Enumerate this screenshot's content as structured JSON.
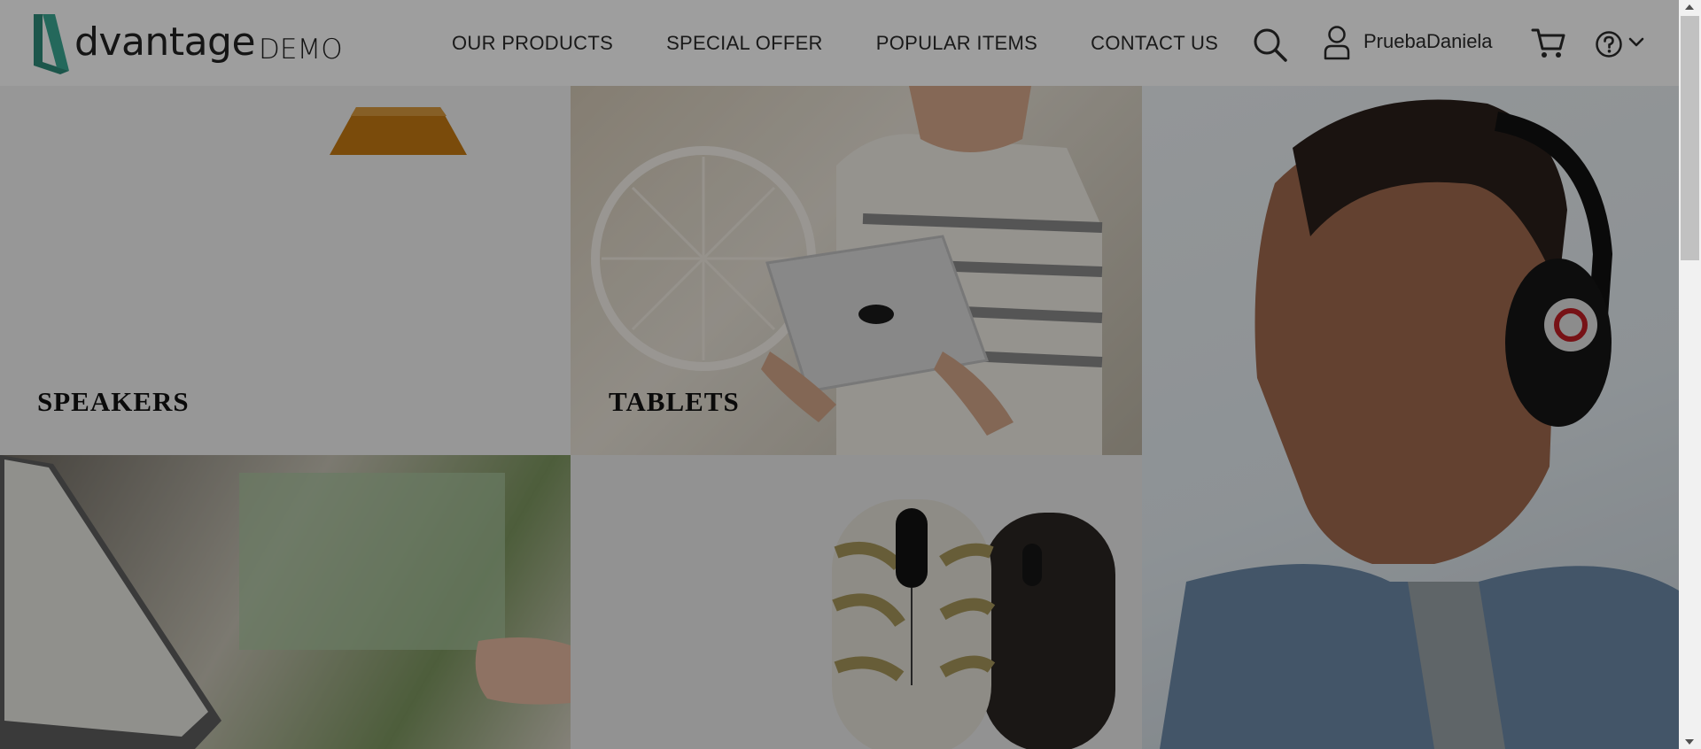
{
  "header": {
    "logo": {
      "word": "dvantage",
      "suffix": "DEMO"
    },
    "nav": [
      {
        "label": "OUR PRODUCTS"
      },
      {
        "label": "SPECIAL OFFER"
      },
      {
        "label": "POPULAR ITEMS"
      },
      {
        "label": "CONTACT US"
      }
    ],
    "icons": {
      "search": "search-icon",
      "user": "user-icon",
      "cart": "cart-icon",
      "help": "help-icon",
      "dropdown": "chevron-down-icon"
    },
    "user_name": "PruebaDaniela"
  },
  "categories": [
    {
      "id": "speakers",
      "label": "SPEAKERS"
    },
    {
      "id": "tablets",
      "label": "TABLETS"
    },
    {
      "id": "headphones",
      "label": ""
    },
    {
      "id": "laptops",
      "label": ""
    },
    {
      "id": "mice",
      "label": ""
    }
  ],
  "colors": {
    "brand": "#2e8b7a",
    "overlay": "rgba(0,0,0,0.38)"
  }
}
